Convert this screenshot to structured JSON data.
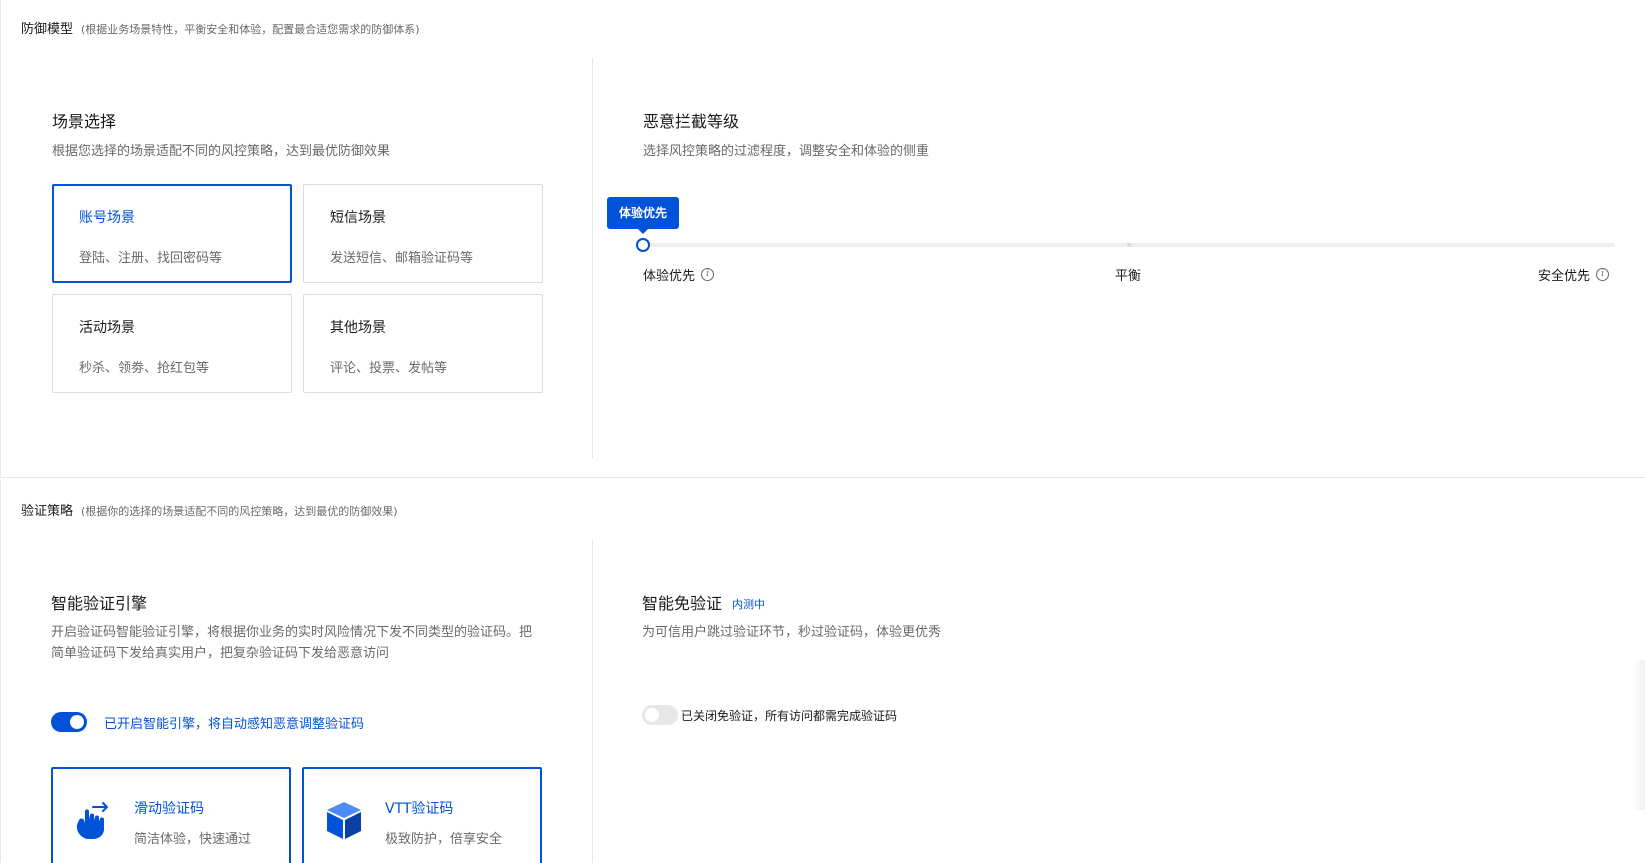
{
  "defense_model": {
    "title": "防御模型",
    "desc": "(根据业务场景特性，平衡安全和体验，配置最合适您需求的防御体系)",
    "scene": {
      "title": "场景选择",
      "desc": "根据您选择的场景适配不同的风控策略，达到最优防御效果",
      "cards": [
        {
          "title": "账号场景",
          "desc": "登陆、注册、找回密码等",
          "selected": true
        },
        {
          "title": "短信场景",
          "desc": "发送短信、邮箱验证码等",
          "selected": false
        },
        {
          "title": "活动场景",
          "desc": "秒杀、领劵、抢红包等",
          "selected": false
        },
        {
          "title": "其他场景",
          "desc": "评论、投票、发帖等",
          "selected": false
        }
      ]
    },
    "intercept": {
      "title": "恶意拦截等级",
      "desc": "选择风控策略的过滤程度，调整安全和体验的侧重",
      "tooltip": "体验优先",
      "level_fraction": 0,
      "labels": [
        "体验优先",
        "平衡",
        "安全优先"
      ]
    }
  },
  "verify_strategy": {
    "title": "验证策略",
    "desc": "(根据你的选择的场景适配不同的风控策略，达到最优的防御效果)",
    "engine": {
      "title": "智能验证引擎",
      "desc": "开启验证码智能验证引擎，将根据你业务的实时风险情况下发不同类型的验证码。把简单验证码下发给真实用户，把复杂验证码下发给恶意访问",
      "toggle_on": true,
      "toggle_label": "已开启智能引擎，将自动感知恶意调整验证码",
      "types": [
        {
          "title": "滑动验证码",
          "desc": "简洁体验，快速通过",
          "icon": "hand-swipe-icon"
        },
        {
          "title": "VTT验证码",
          "desc": "极致防护，倍享安全",
          "icon": "cube-icon"
        }
      ]
    },
    "free_verify": {
      "title": "智能免验证",
      "tag": "内测中",
      "desc": "为可信用户跳过验证环节，秒过验证码，体验更优秀",
      "toggle_on": false,
      "toggle_label": "已关闭免验证，所有访问都需完成验证码"
    }
  },
  "colors": {
    "primary": "#0052d9",
    "border": "#dcdcdc",
    "divider": "#e7e7e7"
  }
}
